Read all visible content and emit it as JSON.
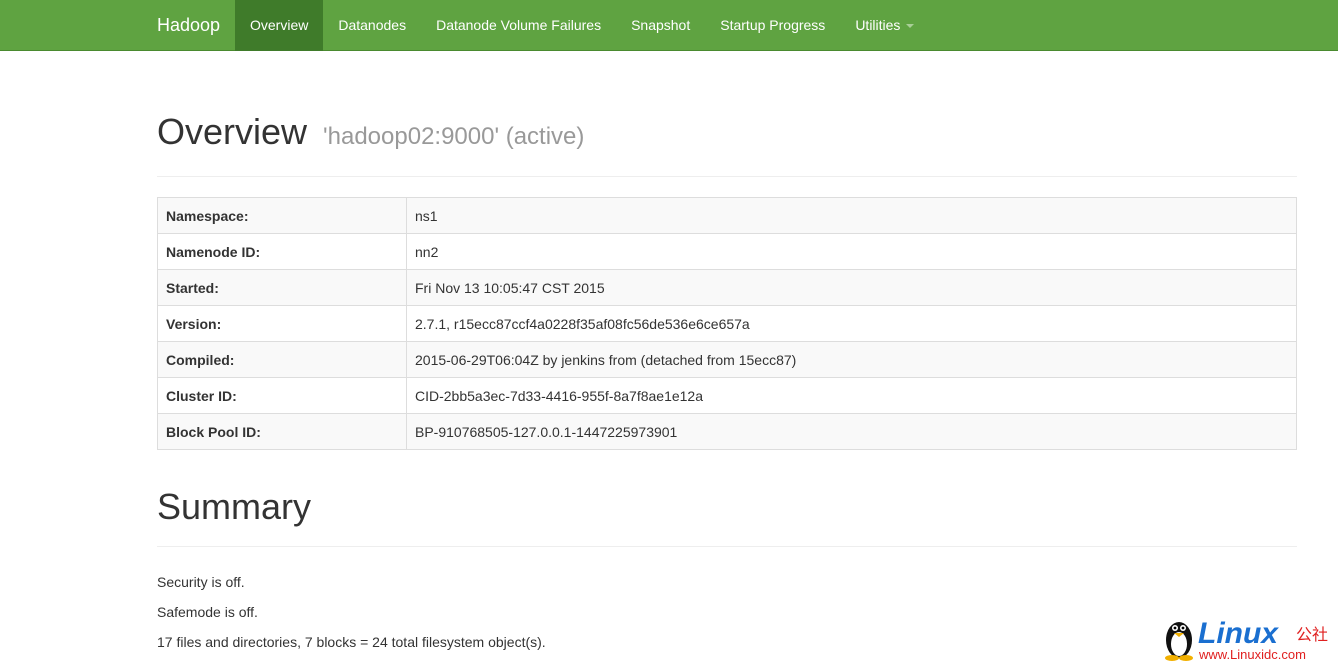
{
  "navbar": {
    "brand": "Hadoop",
    "items": [
      {
        "label": "Overview",
        "active": true
      },
      {
        "label": "Datanodes",
        "active": false
      },
      {
        "label": "Datanode Volume Failures",
        "active": false
      },
      {
        "label": "Snapshot",
        "active": false
      },
      {
        "label": "Startup Progress",
        "active": false
      },
      {
        "label": "Utilities",
        "active": false
      }
    ]
  },
  "overview": {
    "title": "Overview",
    "subtitle": "'hadoop02:9000' (active)",
    "rows": [
      {
        "label": "Namespace:",
        "value": "ns1"
      },
      {
        "label": "Namenode ID:",
        "value": "nn2"
      },
      {
        "label": "Started:",
        "value": "Fri Nov 13 10:05:47 CST 2015"
      },
      {
        "label": "Version:",
        "value": "2.7.1, r15ecc87ccf4a0228f35af08fc56de536e6ce657a"
      },
      {
        "label": "Compiled:",
        "value": "2015-06-29T06:04Z by jenkins from (detached from 15ecc87)"
      },
      {
        "label": "Cluster ID:",
        "value": "CID-2bb5a3ec-7d33-4416-955f-8a7f8ae1e12a"
      },
      {
        "label": "Block Pool ID:",
        "value": "BP-910768505-127.0.0.1-1447225973901"
      }
    ]
  },
  "summary": {
    "title": "Summary",
    "lines": [
      "Security is off.",
      "Safemode is off.",
      "17 files and directories, 7 blocks = 24 total filesystem object(s)."
    ]
  },
  "watermark": {
    "brand": "Linux",
    "cn": "公社",
    "url": "www.Linuxidc.com"
  },
  "colors": {
    "navbar": "#5fa341",
    "navbar_active": "#3f7b2a"
  }
}
